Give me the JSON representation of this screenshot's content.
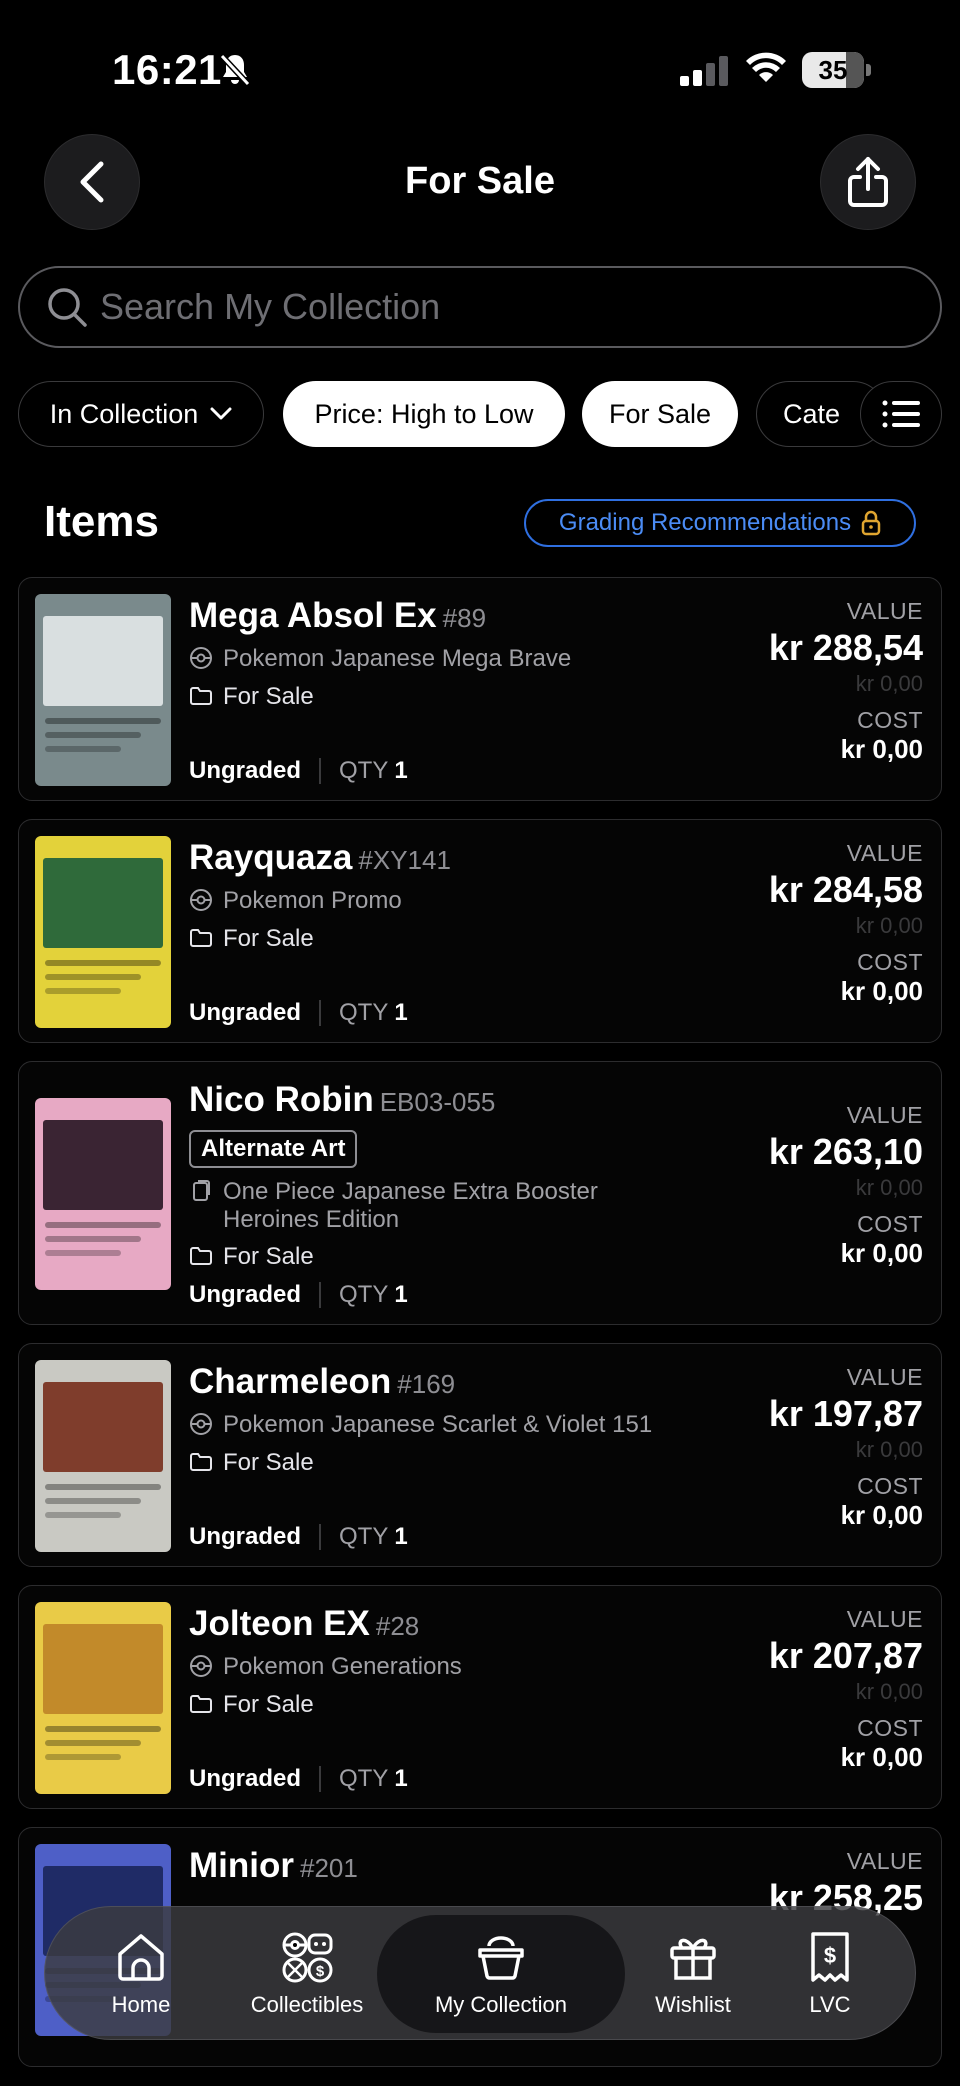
{
  "status": {
    "time": "16:21",
    "battery": "35"
  },
  "header": {
    "title": "For Sale"
  },
  "search": {
    "placeholder": "Search My Collection"
  },
  "filters": [
    "In Collection",
    "Price: High to Low",
    "For Sale",
    "Cate"
  ],
  "items_section": {
    "title": "Items",
    "grading_label": "Grading Recommendations"
  },
  "labels": {
    "value": "VALUE",
    "cost": "COST",
    "qty": "QTY"
  },
  "items": [
    {
      "name": "Mega Absol Ex",
      "number": "#89",
      "set": "Pokemon Japanese Mega Brave",
      "folder": "For Sale",
      "grade": "Ungraded",
      "qty": "1",
      "value": "kr 288,54",
      "change": "kr 0,00",
      "cost": "kr 0,00",
      "colors": [
        "#7a8a8c",
        "#d9dfe0"
      ]
    },
    {
      "name": "Rayquaza",
      "number": "#XY141",
      "set": "Pokemon Promo",
      "folder": "For Sale",
      "grade": "Ungraded",
      "qty": "1",
      "value": "kr 284,58",
      "change": "kr 0,00",
      "cost": "kr 0,00",
      "colors": [
        "#e3d23a",
        "#2f6a3a"
      ]
    },
    {
      "name": "Nico Robin",
      "number": "EB03-055",
      "badge": "Alternate Art",
      "set": "One Piece Japanese Extra Booster Heroines Edition",
      "folder": "For Sale",
      "grade": "Ungraded",
      "qty": "1",
      "value": "kr 263,10",
      "change": "kr 0,00",
      "cost": "kr 0,00",
      "colors": [
        "#e7a9c4",
        "#3a2433"
      ]
    },
    {
      "name": "Charmeleon",
      "number": "#169",
      "set": "Pokemon Japanese Scarlet & Violet 151",
      "folder": "For Sale",
      "grade": "Ungraded",
      "qty": "1",
      "value": "kr 197,87",
      "change": "kr 0,00",
      "cost": "kr 0,00",
      "colors": [
        "#c9c9c3",
        "#7f3d2c"
      ]
    },
    {
      "name": "Jolteon EX",
      "number": "#28",
      "set": "Pokemon Generations",
      "folder": "For Sale",
      "grade": "Ungraded",
      "qty": "1",
      "value": "kr 207,87",
      "change": "kr 0,00",
      "cost": "kr 0,00",
      "colors": [
        "#e9cb47",
        "#c28a2a"
      ]
    },
    {
      "name": "Minior",
      "number": "#201",
      "value": "kr 258,25",
      "colors": [
        "#4e5fc7",
        "#1f2b66"
      ]
    }
  ],
  "nav": [
    "Home",
    "Collectibles",
    "My Collection",
    "Wishlist",
    "LVC"
  ]
}
